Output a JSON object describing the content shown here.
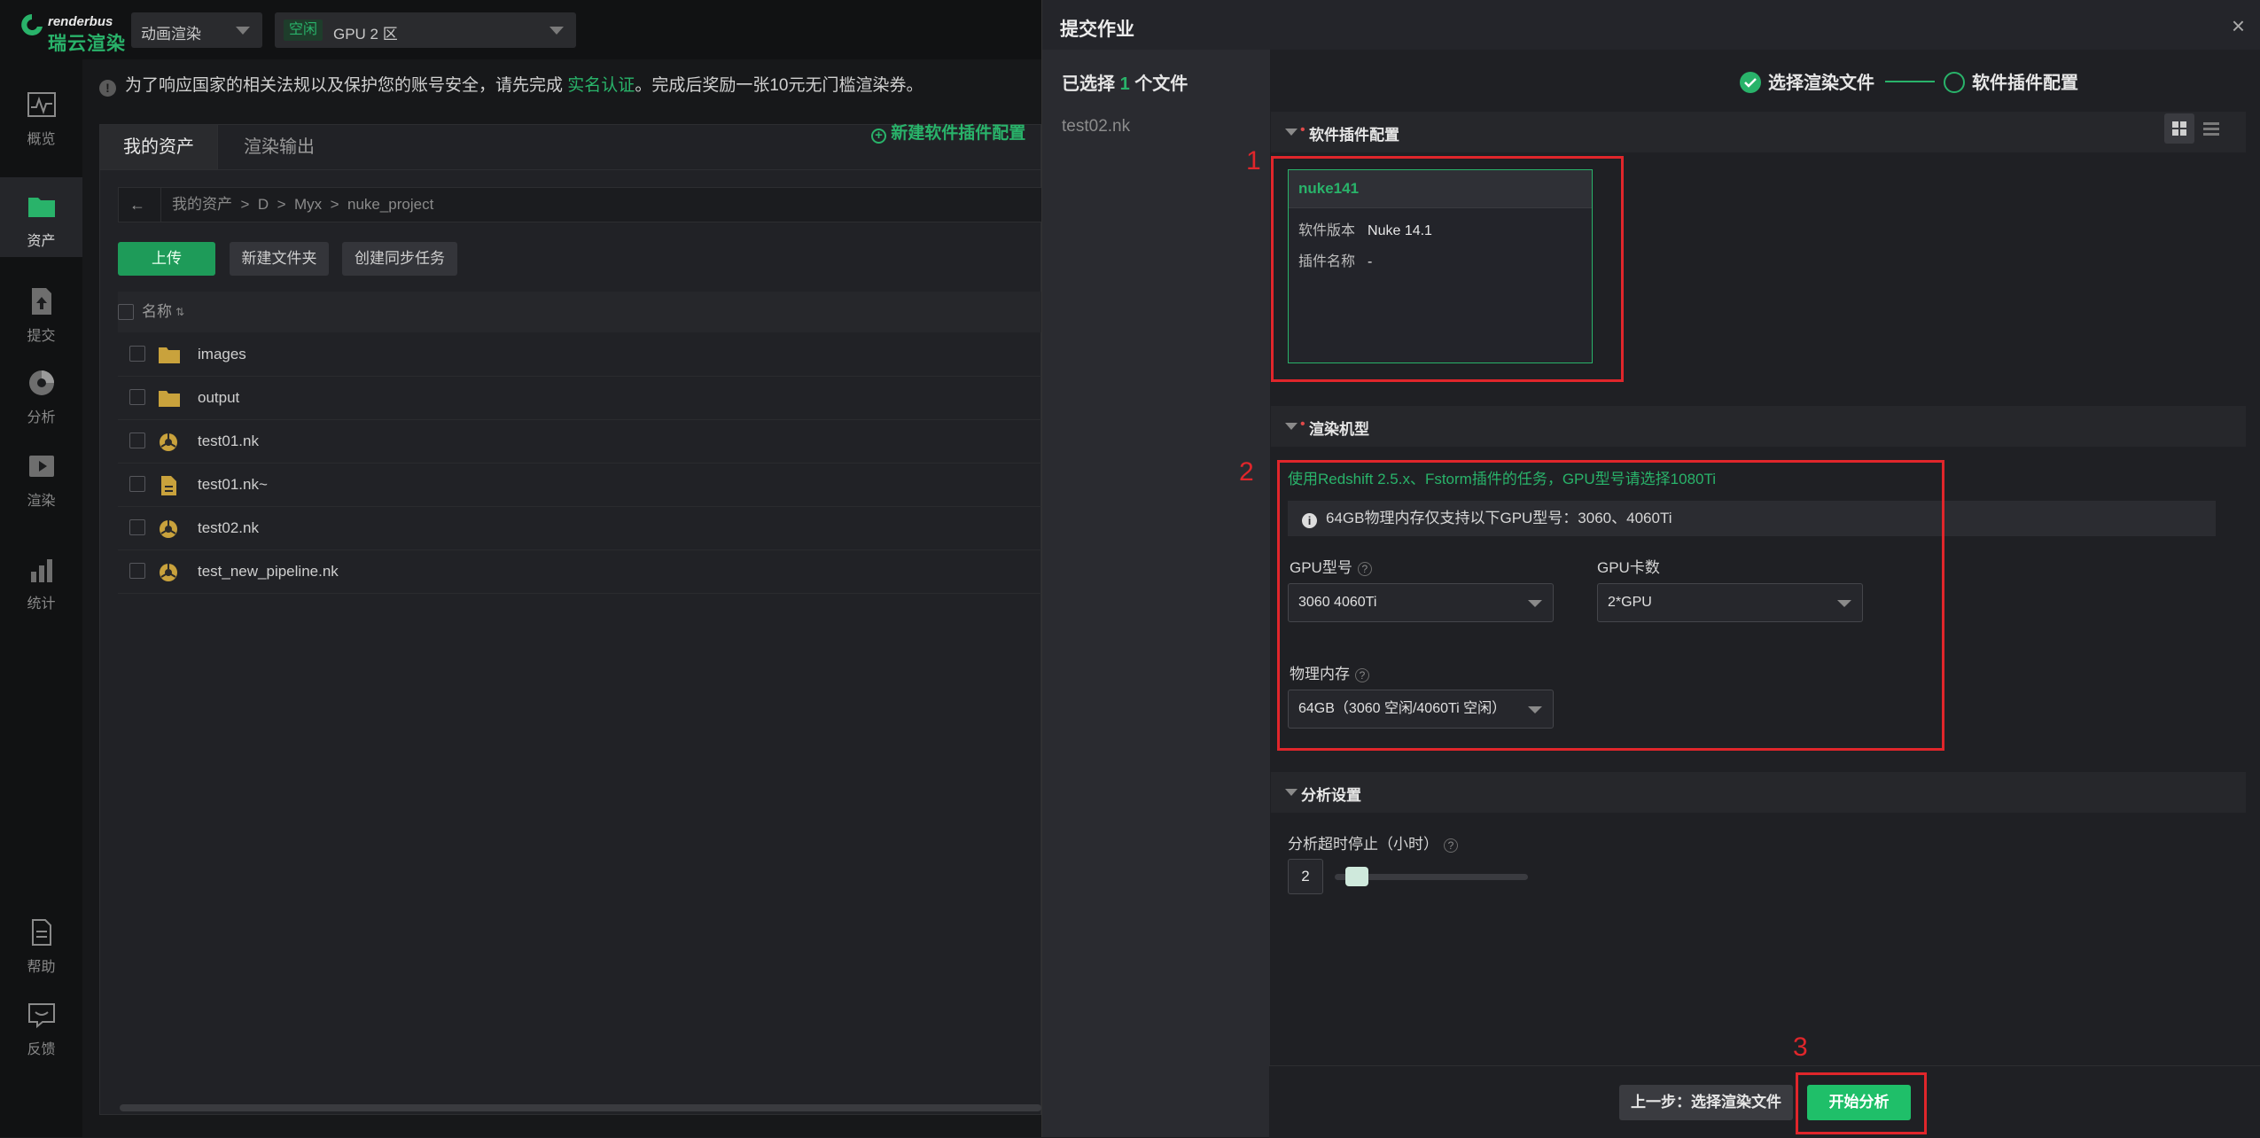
{
  "topbar": {
    "logo_en": "renderbus",
    "logo_cn": "瑞云渲染",
    "mode_dropdown": "动画渲染",
    "status_badge": "空闲",
    "zone_dropdown": "GPU 2 区"
  },
  "nav": [
    {
      "label": "概览",
      "icon": "pulse-icon"
    },
    {
      "label": "资产",
      "icon": "folder-icon"
    },
    {
      "label": "提交",
      "icon": "upload-icon"
    },
    {
      "label": "分析",
      "icon": "analyze-icon"
    },
    {
      "label": "渲染",
      "icon": "play-icon"
    },
    {
      "label": "统计",
      "icon": "bar-chart-icon"
    },
    {
      "label": "帮助",
      "icon": "document-icon"
    },
    {
      "label": "反馈",
      "icon": "feedback-icon"
    }
  ],
  "notice": {
    "text_before": "为了响应国家的相关法规以及保护您的账号安全，请先完成",
    "link": "实名认证",
    "text_after": "。完成后奖励一张10元无门槛渲染券。"
  },
  "assets": {
    "tabs": [
      "我的资产",
      "渲染输出"
    ],
    "breadcrumb": [
      "我的资产",
      ">",
      "D",
      ">",
      "Myx",
      ">",
      "nuke_project"
    ],
    "buttons": {
      "upload": "上传",
      "new_folder": "新建文件夹",
      "sync_task": "创建同步任务"
    },
    "column_name": "名称",
    "rows": [
      {
        "name": "images",
        "type": "folder"
      },
      {
        "name": "output",
        "type": "folder"
      },
      {
        "name": "test01.nk",
        "type": "nuke"
      },
      {
        "name": "test01.nk~",
        "type": "file"
      },
      {
        "name": "test02.nk",
        "type": "nuke"
      },
      {
        "name": "test_new_pipeline.nk",
        "type": "nuke"
      }
    ]
  },
  "modal": {
    "title": "提交作业",
    "close": "×",
    "selected_prefix": "已选择",
    "selected_count": "1",
    "selected_suffix": "个文件",
    "file": "test02.nk",
    "steps": {
      "step1": "选择渲染文件",
      "step2": "软件插件配置"
    },
    "software_section": "软件插件配置",
    "new_config": "新建软件插件配置",
    "card": {
      "name": "nuke141",
      "version_label": "软件版本",
      "version_value": "Nuke 14.1",
      "plugin_label": "插件名称",
      "plugin_value": "-"
    },
    "render_section": "渲染机型",
    "gpu_tip": "使用Redshift 2.5.x、Fstorm插件的任务，GPU型号请选择1080Ti",
    "memory_info": "64GB物理内存仅支持以下GPU型号：3060、4060Ti",
    "gpu_model_label": "GPU型号",
    "gpu_model_value": "3060 4060Ti",
    "gpu_count_label": "GPU卡数",
    "gpu_count_value": "2*GPU",
    "memory_label": "物理内存",
    "memory_value": "64GB（3060 空闲/4060Ti 空闲）",
    "analysis_section": "分析设置",
    "timeout_label": "分析超时停止（小时）",
    "timeout_value": "2",
    "timeout_fraction": 0.06,
    "prev_button": "上一步：选择渲染文件",
    "start_button": "开始分析"
  },
  "annotations": {
    "n1": "1",
    "n2": "2",
    "n3": "3"
  },
  "colors": {
    "accent": "#29b36a",
    "annotation": "#e0262b",
    "background": "#1b1c1e"
  }
}
